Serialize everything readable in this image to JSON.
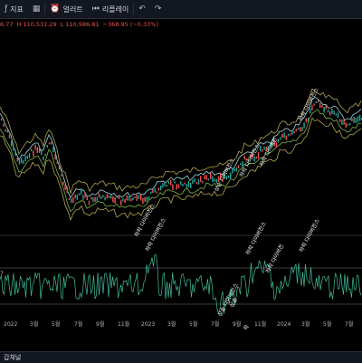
{
  "toolbar": {
    "indicators_label": "지표",
    "alert_label": "얼러트",
    "replay_label": "리플레이"
  },
  "ohlc": {
    "open_fragment": "6.77",
    "high": "H 110,531.29",
    "low": "L 110,986.81",
    "change": "−368.95 (−0.33%)"
  },
  "x_axis": {
    "ticks": [
      "2022",
      "3월",
      "5월",
      "7월",
      "9월",
      "11월",
      "2023",
      "3월",
      "5월",
      "7월",
      "9월",
      "11월",
      "2024",
      "3월",
      "5월",
      "7월"
    ]
  },
  "indicator": {
    "left_value": "7"
  },
  "annotations": {
    "bearish_divergence": "하락 다이버전스",
    "bullish_divergence": "상승 다이버전스",
    "bearish_divergence_alt": "하락 다이버전",
    "bull_short": "상승",
    "bear_short": "하락"
  },
  "footer": {
    "label": "갑채널"
  },
  "colors": {
    "background": "#000000",
    "toolbar": "#131722",
    "ohlc_text": "#ef5350",
    "candle_up": "#26a69a",
    "candle_down": "#ef5350",
    "band_olive": "#b3a54a",
    "band_cyan": "#9fd8e0",
    "band_green": "#7ab648",
    "osc_line": "#3ebf9b"
  }
}
